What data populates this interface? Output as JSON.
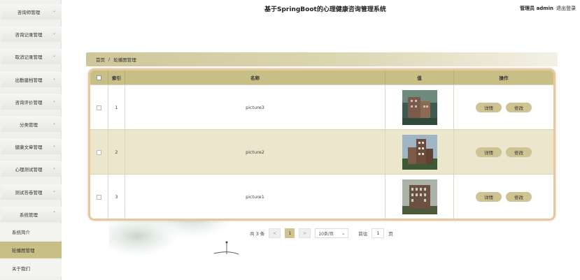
{
  "header": {
    "title": "基于SpringBoot的心理健康咨询管理系统",
    "user": "管理员 admin",
    "logout": "退出登录"
  },
  "sidebar": {
    "items": [
      {
        "label": "咨询师管理"
      },
      {
        "label": "咨询记录管理"
      },
      {
        "label": "取消记录管理"
      },
      {
        "label": "出勤建档管理"
      },
      {
        "label": "咨询评价管理"
      },
      {
        "label": "分类管理"
      },
      {
        "label": "健康文章管理"
      },
      {
        "label": "心理测试管理"
      },
      {
        "label": "测试答卷管理"
      },
      {
        "label": "系统管理"
      }
    ],
    "sub_items": [
      {
        "label": "系统简介",
        "active": false
      },
      {
        "label": "轮播图管理",
        "active": true
      },
      {
        "label": "关于我们",
        "active": false
      }
    ],
    "chevron": "chevron-down-icon"
  },
  "breadcrumb": {
    "home": "首页",
    "separator": "/",
    "current": "轮播图管理"
  },
  "table": {
    "headers": {
      "index": "索引",
      "name": "名称",
      "value": "值",
      "actions": "操作"
    },
    "rows": [
      {
        "index": "1",
        "name": "picture3",
        "image": "building-photo-icon"
      },
      {
        "index": "2",
        "name": "picture2",
        "image": "building-photo-icon"
      },
      {
        "index": "3",
        "name": "picture1",
        "image": "building-photo-icon"
      }
    ],
    "detail_label": "详情",
    "edit_label": "修改"
  },
  "pagination": {
    "total": "共 3 条",
    "prev": "<",
    "current": "1",
    "next": ">",
    "page_size": "10条/页",
    "goto_label": "前往",
    "goto_value": "1",
    "page_unit": "页"
  },
  "colors": {
    "accent": "#c8bf86",
    "button": "#cec392",
    "alt_row": "#ebe6cc",
    "table_border": "#e6c79e"
  }
}
